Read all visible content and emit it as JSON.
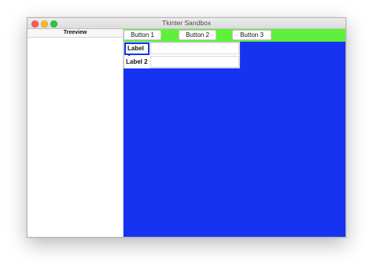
{
  "window": {
    "title": "Tkinter Sandbox"
  },
  "treeview": {
    "header": "Treeview"
  },
  "toolbar": {
    "button1": "Button 1",
    "button2": "Button 2",
    "button3": "Button 3"
  },
  "form": {
    "label1": "Label 1",
    "label2": "Label 2",
    "entry1_value": "",
    "entry2_value": ""
  },
  "colors": {
    "green_bar": "#5ef03a",
    "blue_frame": "#1733f2"
  }
}
